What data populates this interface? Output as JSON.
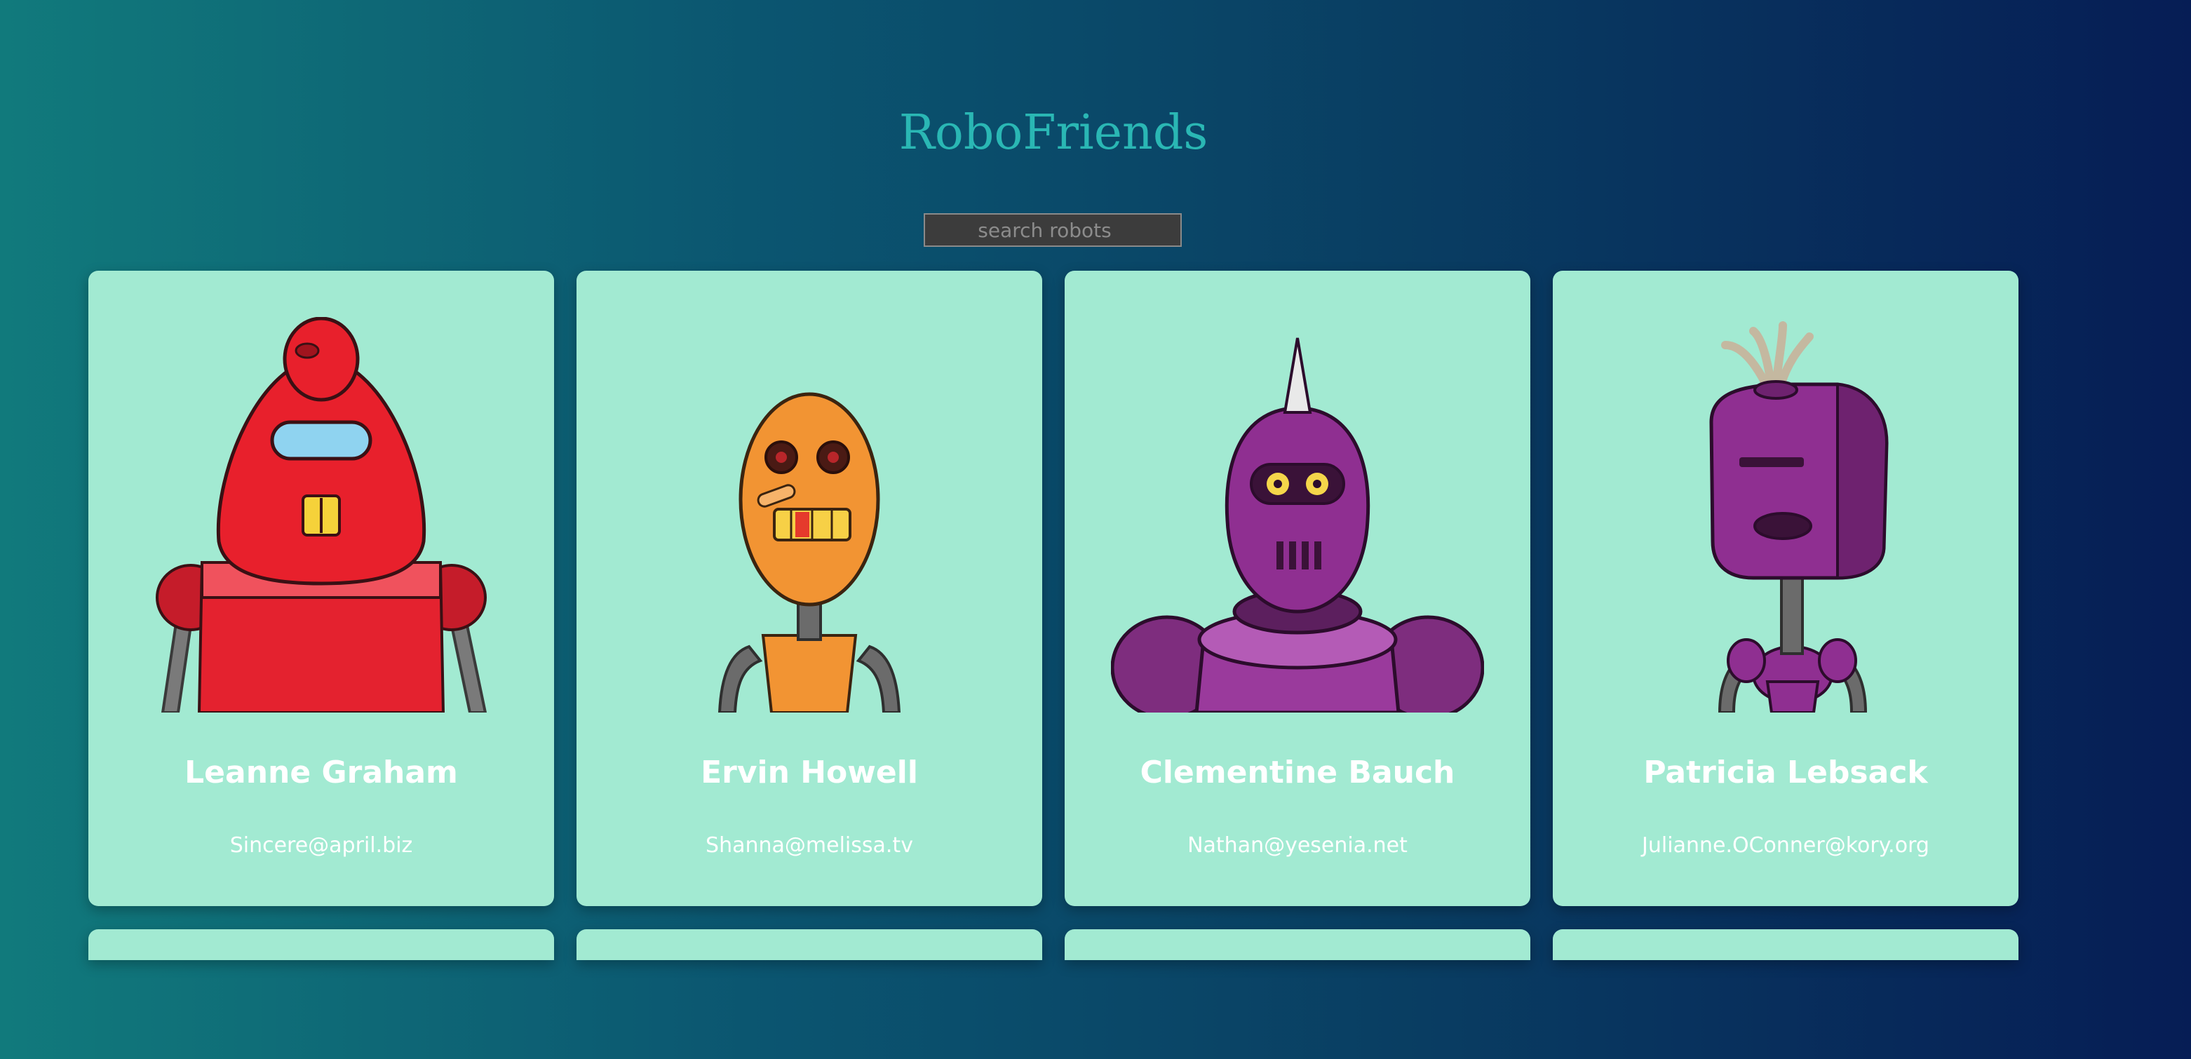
{
  "header": {
    "title": "RoboFriends"
  },
  "search": {
    "placeholder": "search robots",
    "value": ""
  },
  "colors": {
    "title": "#2ab7b4",
    "card_background": "#a2ead2",
    "page_gradient_start": "#117a7c",
    "page_gradient_end": "#061d55"
  },
  "robots": [
    {
      "name": "Leanne Graham",
      "email": "Sincere@april.biz",
      "avatar": "red-robot-avatar"
    },
    {
      "name": "Ervin Howell",
      "email": "Shanna@melissa.tv",
      "avatar": "orange-robot-avatar"
    },
    {
      "name": "Clementine Bauch",
      "email": "Nathan@yesenia.net",
      "avatar": "purple-spike-robot-avatar"
    },
    {
      "name": "Patricia Lebsack",
      "email": "Julianne.OConner@kory.org",
      "avatar": "purple-antenna-robot-avatar"
    }
  ]
}
